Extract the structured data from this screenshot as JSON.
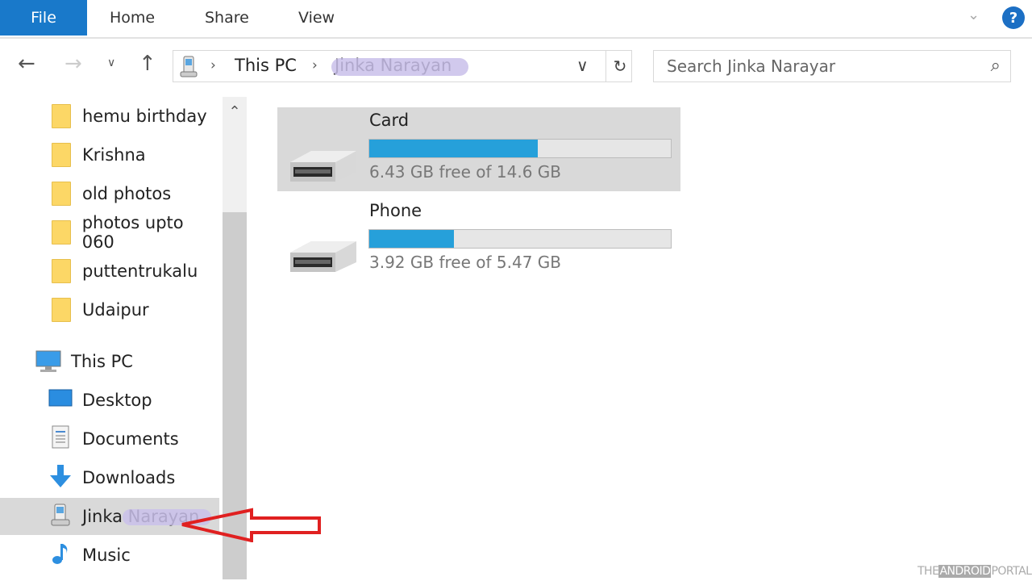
{
  "ribbon": {
    "tabs": [
      "File",
      "Home",
      "Share",
      "View"
    ],
    "help_label": "?"
  },
  "nav": {
    "back_icon": "arrow-left-icon",
    "forward_icon": "arrow-right-icon",
    "recent_icon": "chevron-down-icon",
    "up_icon": "arrow-up-icon",
    "breadcrumb": [
      "This PC",
      "Jinka Narayan"
    ],
    "refresh_icon": "refresh-icon"
  },
  "search": {
    "placeholder": "Search Jinka Narayar"
  },
  "sidebar": {
    "folders": [
      "hemu birthday",
      "Krishna",
      "old photos",
      "photos upto 060",
      "puttentrukalu",
      "Udaipur"
    ],
    "this_pc": "This PC",
    "items": [
      {
        "label": "Desktop",
        "icon": "desktop-icon"
      },
      {
        "label": "Documents",
        "icon": "documents-icon"
      },
      {
        "label": "Downloads",
        "icon": "downloads-icon"
      },
      {
        "label": "Jinka Narayan",
        "icon": "phone-device-icon",
        "selected": true
      },
      {
        "label": "Music",
        "icon": "music-icon"
      }
    ]
  },
  "drives": [
    {
      "name": "Card",
      "free_text": "6.43 GB free of 14.6 GB",
      "used_fraction": 0.56,
      "selected": true
    },
    {
      "name": "Phone",
      "free_text": "3.92 GB free of 5.47 GB",
      "used_fraction": 0.28,
      "selected": false
    }
  ],
  "colors": {
    "accent": "#1979ca",
    "bar_fill": "#26a0da",
    "annotation_arrow": "#e02020"
  },
  "watermark": {
    "pre": "THE",
    "box": "ANDROID",
    "post": "PORTAL"
  }
}
